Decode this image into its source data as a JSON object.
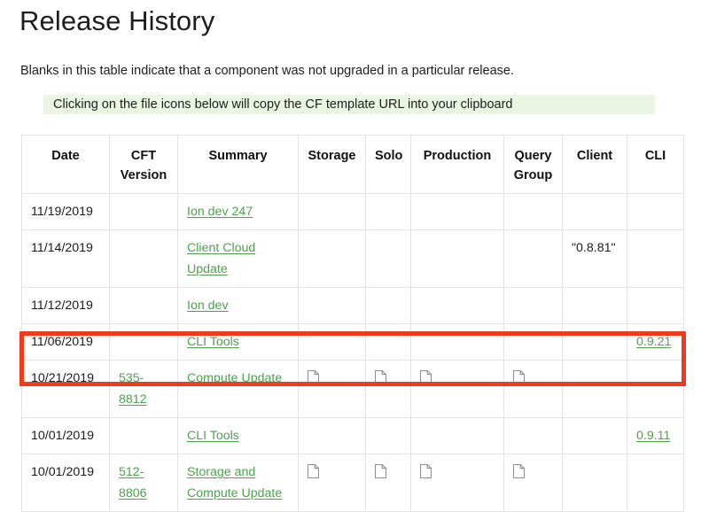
{
  "document": {
    "title": "Release History",
    "intro": "Blanks in this table indicate that a component was not upgraded in a particular release.",
    "note": "Clicking on the file icons below will copy the CF template URL into your clipboard"
  },
  "colors": {
    "link_green": "#4fa04f",
    "note_background": "#eaf5e2",
    "highlight_red": "#ee3b1d",
    "table_border": "#e3e3e3"
  },
  "table": {
    "columns": [
      {
        "key": "date",
        "label": "Date"
      },
      {
        "key": "cft_version",
        "label": "CFT Version"
      },
      {
        "key": "summary",
        "label": "Summary"
      },
      {
        "key": "storage",
        "label": "Storage"
      },
      {
        "key": "solo",
        "label": "Solo"
      },
      {
        "key": "production",
        "label": "Production"
      },
      {
        "key": "query_group",
        "label": "Query Group"
      },
      {
        "key": "client",
        "label": "Client"
      },
      {
        "key": "cli",
        "label": "CLI"
      }
    ],
    "rows": [
      {
        "date": "11/19/2019",
        "cft_version": "",
        "summary": "Ion dev 247",
        "storage": "",
        "solo": "",
        "production": "",
        "query_group": "",
        "client": "",
        "cli": ""
      },
      {
        "date": "11/14/2019",
        "cft_version": "",
        "summary": "Client Cloud Update",
        "storage": "",
        "solo": "",
        "production": "",
        "query_group": "",
        "client": "\"0.8.81\"",
        "cli": ""
      },
      {
        "date": "11/12/2019",
        "cft_version": "",
        "summary": "Ion dev",
        "storage": "",
        "solo": "",
        "production": "",
        "query_group": "",
        "client": "",
        "cli": ""
      },
      {
        "date": "11/06/2019",
        "cft_version": "",
        "summary": "CLI Tools",
        "storage": "",
        "solo": "",
        "production": "",
        "query_group": "",
        "client": "",
        "cli": "0.9.21"
      },
      {
        "date": "10/21/2019",
        "cft_version": "535-8812",
        "summary": "Compute Update",
        "storage": "file-icon",
        "solo": "file-icon",
        "production": "file-icon",
        "query_group": "file-icon",
        "client": "",
        "cli": "",
        "highlighted": true
      },
      {
        "date": "10/01/2019",
        "cft_version": "",
        "summary": "CLI Tools",
        "storage": "",
        "solo": "",
        "production": "",
        "query_group": "",
        "client": "",
        "cli": "0.9.11"
      },
      {
        "date": "10/01/2019",
        "cft_version": "512-8806",
        "summary": "Storage and Compute Update",
        "storage": "file-icon",
        "solo": "file-icon",
        "production": "file-icon",
        "query_group": "file-icon",
        "client": "",
        "cli": ""
      }
    ]
  }
}
